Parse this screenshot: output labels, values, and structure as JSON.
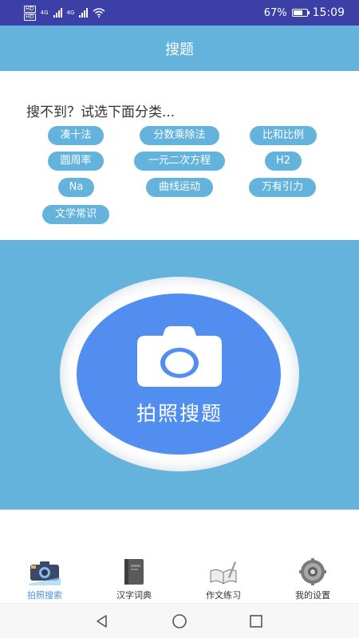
{
  "status_bar": {
    "battery": "67%",
    "time": "15:09",
    "net_label": "4G",
    "hd_label": "HD"
  },
  "header": {
    "title": "搜题"
  },
  "categories": {
    "prompt": "搜不到？试选下面分类...",
    "tags": [
      "凑十法",
      "分数乘除法",
      "比和比例",
      "圆周率",
      "一元二次方程",
      "H2",
      "Na",
      "曲线运动",
      "万有引力",
      "文学常识"
    ]
  },
  "camera": {
    "label": "拍照搜题"
  },
  "bottom_nav": {
    "items": [
      {
        "label": "拍照搜索",
        "icon": "camera-search-icon",
        "active": true
      },
      {
        "label": "汉字词典",
        "icon": "book-icon",
        "active": false
      },
      {
        "label": "作文练习",
        "icon": "open-book-pen-icon",
        "active": false
      },
      {
        "label": "我的设置",
        "icon": "gear-icon",
        "active": false
      }
    ]
  },
  "colors": {
    "accent": "#63b3dc",
    "camera_blue": "#528ef0",
    "status_bar": "#3b3fa6",
    "active_nav": "#4a90e2"
  }
}
